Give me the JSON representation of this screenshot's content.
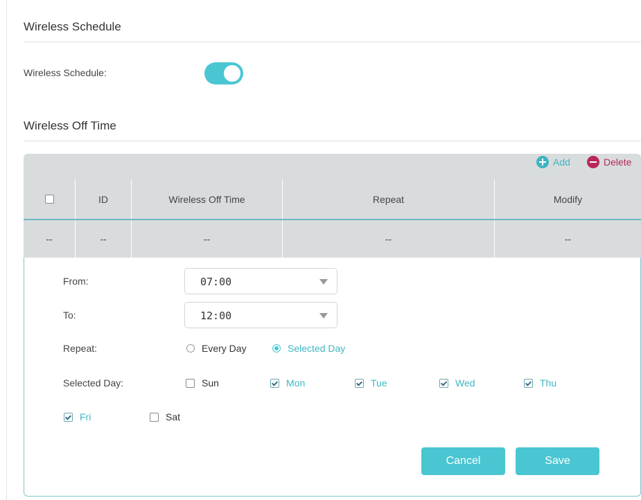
{
  "sections": {
    "schedule_title": "Wireless Schedule",
    "off_time_title": "Wireless Off Time"
  },
  "schedule": {
    "label": "Wireless Schedule:",
    "enabled": true,
    "accent_color": "#4ac6d2"
  },
  "toolbar": {
    "add_label": "Add",
    "delete_label": "Delete",
    "add_icon": "plus-circle-icon",
    "delete_icon": "minus-circle-icon",
    "delete_color": "#b8285b"
  },
  "table": {
    "columns": [
      "ID",
      "Wireless Off Time",
      "Repeat",
      "Modify"
    ],
    "rows": [
      [
        "--",
        "--",
        "--",
        "--",
        "--"
      ]
    ]
  },
  "form": {
    "from_label": "From:",
    "from_value": "07:00",
    "to_label": "To:",
    "to_value": "12:00",
    "repeat_label": "Repeat:",
    "repeat_options": [
      "Every Day",
      "Selected Day"
    ],
    "repeat_selected": "Selected Day",
    "selected_day_label": "Selected Day:",
    "days": [
      {
        "label": "Sun",
        "checked": false
      },
      {
        "label": "Mon",
        "checked": true
      },
      {
        "label": "Tue",
        "checked": true
      },
      {
        "label": "Wed",
        "checked": true
      },
      {
        "label": "Thu",
        "checked": true
      },
      {
        "label": "Fri",
        "checked": true
      },
      {
        "label": "Sat",
        "checked": false
      }
    ],
    "cancel_label": "Cancel",
    "save_label": "Save"
  }
}
